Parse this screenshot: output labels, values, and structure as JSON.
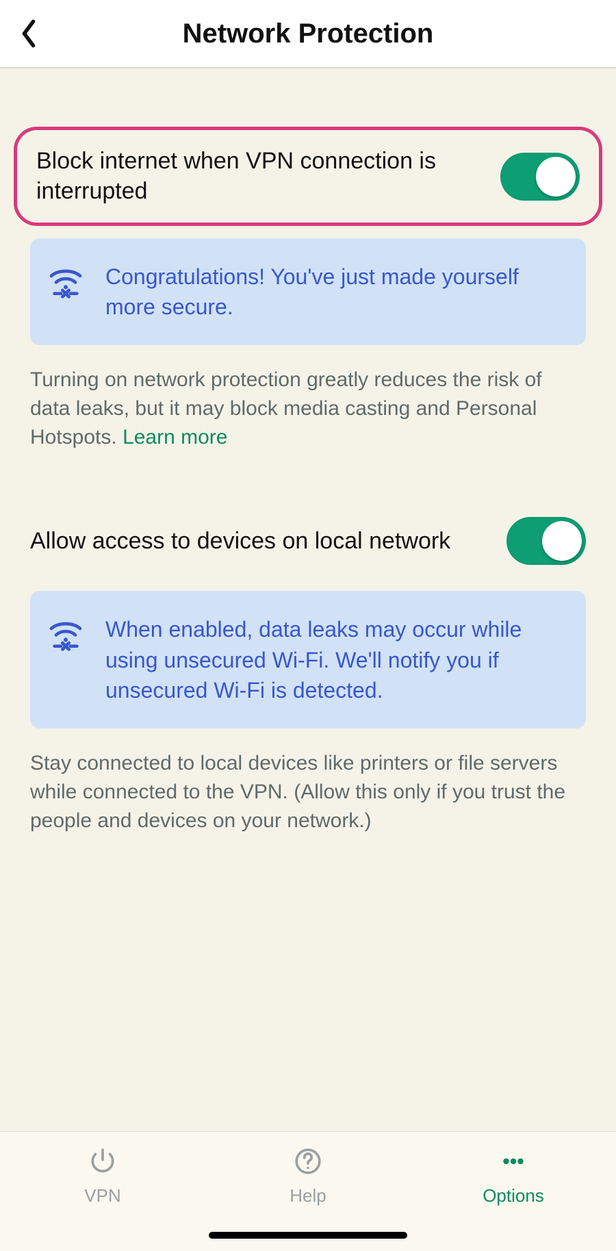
{
  "header": {
    "title": "Network Protection"
  },
  "settings": {
    "block_internet": {
      "label": "Block internet when VPN connection is interrupted",
      "enabled": true,
      "info": "Congratulations! You've just made yourself more secure.",
      "description": "Turning on network protection greatly reduces the risk of data leaks, but it may block media casting and Personal Hotspots. ",
      "learn_more": "Learn more"
    },
    "local_network": {
      "label": "Allow access to devices on local network",
      "enabled": true,
      "info": "When enabled, data leaks may occur while using unsecured Wi-Fi. We'll notify you if unsecured Wi-Fi is detected.",
      "description": "Stay connected to local devices like printers or file servers while connected to the VPN. (Allow this only if you trust the people and devices on your network.)"
    }
  },
  "tabs": {
    "vpn": "VPN",
    "help": "Help",
    "options": "Options"
  },
  "colors": {
    "accent_green": "#0d9e74",
    "highlight_pink": "#d83b7c",
    "info_bg": "#d1e2f7",
    "info_text": "#3a56cd",
    "bg": "#f5f3e8"
  }
}
